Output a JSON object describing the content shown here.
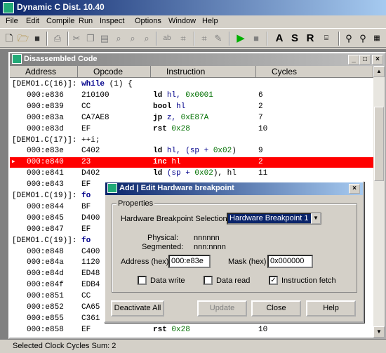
{
  "app": {
    "title": "Dynamic C Dist. 10.40",
    "menu": [
      "File",
      "Edit",
      "Compile",
      "Run",
      "Inspect",
      "Options",
      "Window",
      "Help"
    ],
    "toolbar_text_buttons": [
      "A",
      "S",
      "R"
    ]
  },
  "child_window": {
    "title": "Disassembled Code",
    "columns": [
      "Address",
      "Opcode",
      "Instruction",
      "Cycles"
    ],
    "rows": [
      {
        "source": "[DEMO1.C(16)]: ",
        "kw": "while",
        "rest": " (1) {"
      },
      {
        "addr": "000:e836",
        "op": "210100",
        "mn": "ld",
        "args": "hl, ",
        "num": "0x0001",
        "cyc": "6"
      },
      {
        "addr": "000:e839",
        "op": "CC",
        "mn": "bool",
        "args": "hl",
        "num": "",
        "cyc": "2"
      },
      {
        "addr": "000:e83a",
        "op": "CA7AE8",
        "mn": "jp",
        "args": "z, ",
        "num": "0xE87A",
        "cyc": "7"
      },
      {
        "addr": "000:e83d",
        "op": "EF",
        "mn": "rst",
        "args": "",
        "num": "0x28",
        "cyc": "10"
      },
      {
        "source": "[DEMO1.C(17)]: ++i;",
        "kw": "",
        "rest": ""
      },
      {
        "addr": "000:e83e",
        "op": "C402",
        "mn": "ld",
        "args": "hl, (sp + ",
        "num": "0x02",
        "tail": ")",
        "cyc": "9"
      },
      {
        "addr": "000:e840",
        "op": "23",
        "mn": "inc",
        "args": "hl",
        "num": "",
        "cyc": "2",
        "highlight": true
      },
      {
        "addr": "000:e841",
        "op": "D402",
        "mn": "ld",
        "args": "(sp + ",
        "num": "0x02",
        "tail": "), hl",
        "cyc": "11"
      },
      {
        "addr": "000:e843",
        "op": "EF",
        "mn": "",
        "args": "",
        "num": "",
        "cyc": ""
      },
      {
        "source": "[DEMO1.C(19)]: ",
        "kw": "fo",
        "rest": ""
      },
      {
        "addr": "000:e844",
        "op": "BF",
        "mn": "",
        "args": "",
        "num": "",
        "cyc": ""
      },
      {
        "addr": "000:e845",
        "op": "D400",
        "mn": "",
        "args": "",
        "num": "",
        "cyc": ""
      },
      {
        "addr": "000:e847",
        "op": "EF",
        "mn": "",
        "args": "",
        "num": "",
        "cyc": ""
      },
      {
        "source": "[DEMO1.C(19)]: ",
        "kw": "fo",
        "rest": ""
      },
      {
        "addr": "000:e848",
        "op": "C400",
        "mn": "",
        "args": "",
        "num": "",
        "cyc": ""
      },
      {
        "addr": "000:e84a",
        "op": "1120",
        "mn": "",
        "args": "",
        "num": "",
        "cyc": ""
      },
      {
        "addr": "000:e84d",
        "op": "ED48",
        "mn": "",
        "args": "",
        "num": "",
        "cyc": ""
      },
      {
        "addr": "000:e84f",
        "op": "EDB4",
        "mn": "",
        "args": "",
        "num": "",
        "cyc": ""
      },
      {
        "addr": "000:e851",
        "op": "CC",
        "mn": "",
        "args": "",
        "num": "",
        "cyc": ""
      },
      {
        "addr": "000:e852",
        "op": "CA65",
        "mn": "",
        "args": "",
        "num": "",
        "cyc": ""
      },
      {
        "addr": "000:e855",
        "op": "C361",
        "mn": "",
        "args": "",
        "num": "",
        "cyc": ""
      },
      {
        "addr": "000:e858",
        "op": "EF",
        "mn": "rst",
        "args": "",
        "num": "0x28",
        "cyc": "10"
      }
    ]
  },
  "dialog": {
    "title": "Add | Edit Hardware breakpoint",
    "group_label": "Properties",
    "selection_label": "Hardware Breakpoint Selection:",
    "selection_value": "Hardware Breakpoint 1",
    "physical_label": "Physical:",
    "physical_value": "nnnnnn",
    "segmented_label": "Segmented:",
    "segmented_value": "nnn:nnnn",
    "address_label": "Address (hex)",
    "address_value": "000:e83e",
    "mask_label": "Mask (hex)",
    "mask_value": "0x000000",
    "data_write_label": "Data write",
    "data_write_checked": false,
    "data_read_label": "Data read",
    "data_read_checked": false,
    "instruction_fetch_label": "Instruction fetch",
    "instruction_fetch_checked": true,
    "deactivate_label": "Deactivate All",
    "update_label": "Update",
    "close_label": "Close",
    "help_label": "Help"
  },
  "status": {
    "text": "Selected Clock Cycles Sum: 2"
  }
}
